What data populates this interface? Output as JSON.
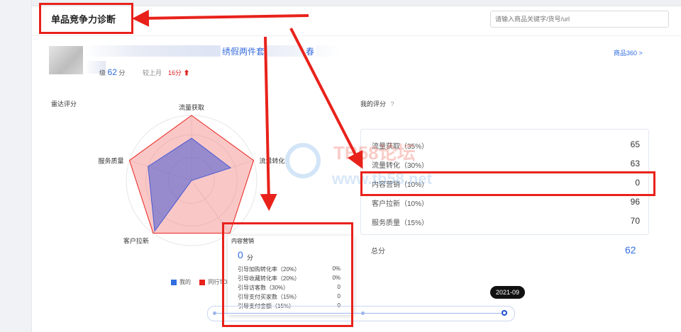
{
  "header": {
    "title": "单品竞争力诊断",
    "search_placeholder": "请输入商品关键字/货号/url"
  },
  "product": {
    "title_visible": "绣假两件套",
    "title_suffix": "春",
    "grade_label": "级",
    "score": "62",
    "score_unit": "分",
    "compare_label": "较上月",
    "compare_delta": "16分",
    "compare_direction": "up",
    "link_label": "商品360 >"
  },
  "radar_section": {
    "title": "雷达评分"
  },
  "chart_data": {
    "type": "radar",
    "axes": [
      "流量获取",
      "流量转化",
      "内容营销",
      "客户拉新",
      "服务质量"
    ],
    "series": [
      {
        "name": "我的",
        "values": [
          65,
          63,
          0,
          96,
          70
        ]
      },
      {
        "name": "同行TOP",
        "values": [
          100,
          100,
          100,
          100,
          100
        ]
      }
    ],
    "max": 100,
    "legend": [
      "我的",
      "同行TOP"
    ],
    "colors": {
      "mine": "#2f6de0",
      "top": "#e8221b"
    }
  },
  "my_scores": {
    "title": "我的评分",
    "help_icon": "question-circle-icon",
    "items": [
      {
        "label": "流量获取（35%）",
        "value": "65"
      },
      {
        "label": "流量转化（30%）",
        "value": "63"
      },
      {
        "label": "内容营销（10%）",
        "value": "0"
      },
      {
        "label": "客户拉新（10%）",
        "value": "96"
      },
      {
        "label": "服务质量（15%）",
        "value": "70"
      }
    ],
    "total_label": "总分",
    "total_value": "62"
  },
  "tooltip": {
    "title": "内容营销",
    "score": "0",
    "unit": "分",
    "rows": [
      {
        "label": "引导加购转化率（20%）",
        "value": "0%"
      },
      {
        "label": "引导收藏转化率（20%）",
        "value": "0%"
      },
      {
        "label": "引导访客数（30%）",
        "value": "0"
      },
      {
        "label": "引导支付买家数（15%）",
        "value": "0"
      },
      {
        "label": "引导支付金额（15%）",
        "value": "0"
      }
    ]
  },
  "timeline": {
    "selected_month": "2021-09",
    "positions": 3
  },
  "watermark": {
    "line1": "TB58论坛",
    "line2": "www.tb58.net"
  },
  "annotation_color": "#e8221b"
}
